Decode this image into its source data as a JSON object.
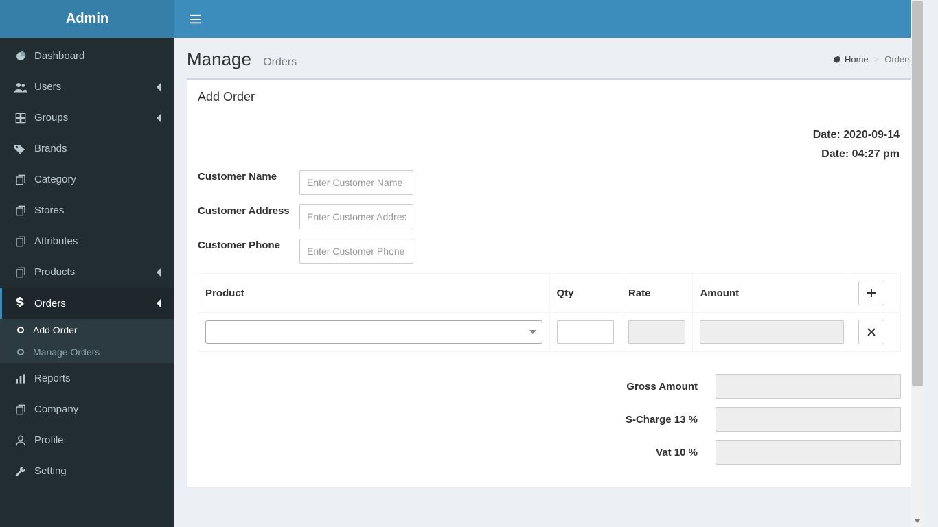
{
  "brand": "Admin",
  "sidebar": {
    "items": [
      {
        "label": "Dashboard",
        "icon": "dashboard-icon",
        "expandable": false
      },
      {
        "label": "Users",
        "icon": "users-icon",
        "expandable": true
      },
      {
        "label": "Groups",
        "icon": "groups-icon",
        "expandable": true
      },
      {
        "label": "Brands",
        "icon": "tags-icon",
        "expandable": false
      },
      {
        "label": "Category",
        "icon": "files-icon",
        "expandable": false
      },
      {
        "label": "Stores",
        "icon": "files-icon",
        "expandable": false
      },
      {
        "label": "Attributes",
        "icon": "files-icon",
        "expandable": false
      },
      {
        "label": "Products",
        "icon": "files-icon",
        "expandable": true
      },
      {
        "label": "Orders",
        "icon": "dollar-icon",
        "expandable": true,
        "active": true,
        "children": [
          {
            "label": "Add Order",
            "current": true
          },
          {
            "label": "Manage Orders",
            "current": false
          }
        ]
      },
      {
        "label": "Reports",
        "icon": "bar-chart-icon",
        "expandable": false
      },
      {
        "label": "Company",
        "icon": "files-icon",
        "expandable": false
      },
      {
        "label": "Profile",
        "icon": "user-icon",
        "expandable": false
      },
      {
        "label": "Setting",
        "icon": "wrench-icon",
        "expandable": false
      }
    ]
  },
  "page": {
    "title": "Manage",
    "subtitle": "Orders",
    "breadcrumb_home": "Home",
    "breadcrumb_active": "Orders"
  },
  "box": {
    "title": "Add Order",
    "date_label": "Date: 2020-09-14",
    "time_label": "Date: 04:27 pm",
    "fields": {
      "customer_name": {
        "label": "Customer Name",
        "placeholder": "Enter Customer Name"
      },
      "customer_address": {
        "label": "Customer Address",
        "placeholder": "Enter Customer Address"
      },
      "customer_phone": {
        "label": "Customer Phone",
        "placeholder": "Enter Customer Phone"
      }
    },
    "table": {
      "headers": {
        "product": "Product",
        "qty": "Qty",
        "rate": "Rate",
        "amount": "Amount"
      },
      "rows": [
        {
          "product": "",
          "qty": "",
          "rate": "",
          "amount": ""
        }
      ]
    },
    "totals": {
      "gross": {
        "label": "Gross Amount",
        "value": ""
      },
      "scharge": {
        "label": "S-Charge 13 %",
        "value": ""
      },
      "vat": {
        "label": "Vat 10 %",
        "value": ""
      }
    }
  }
}
